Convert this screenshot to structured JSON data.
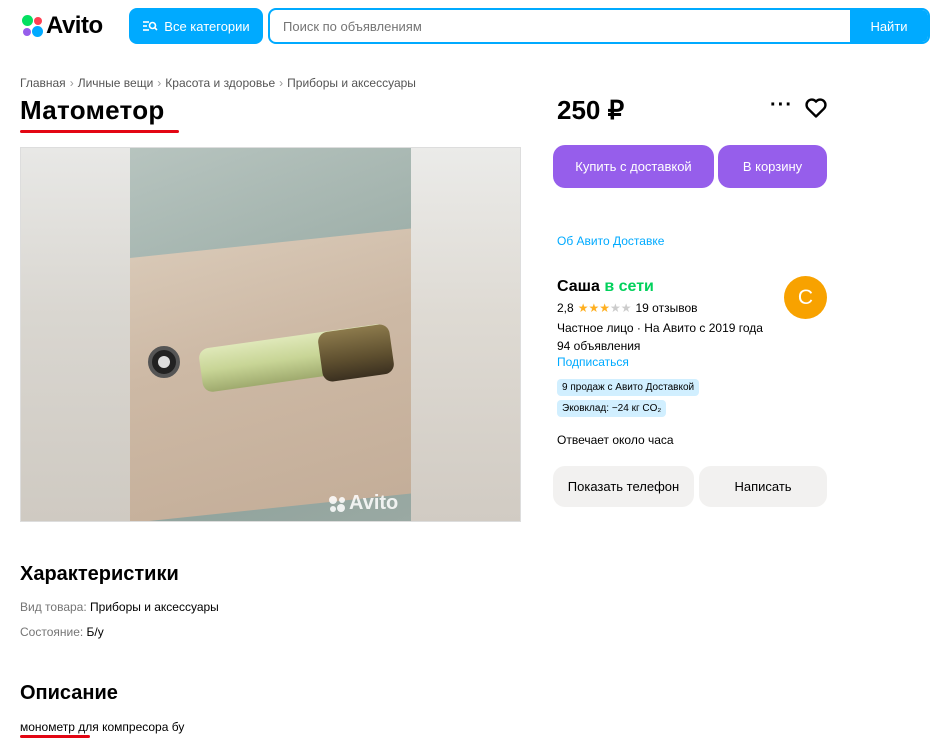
{
  "header": {
    "logo_text": "Avito",
    "categories_label": "Все категории",
    "search_placeholder": "Поиск по объявлениям",
    "search_button": "Найти"
  },
  "breadcrumbs": [
    "Главная",
    "Личные вещи",
    "Красота и здоровье",
    "Приборы и аксессуары"
  ],
  "breadcrumb_separator": "›",
  "listing": {
    "title": "Матометор",
    "price": "250 ₽",
    "watermark": "Avito"
  },
  "actions": {
    "buy_delivery": "Купить с доставкой",
    "add_to_cart": "В корзину",
    "delivery_info": "Об Авито Доставке"
  },
  "seller": {
    "name": "Саша",
    "status": "в сети",
    "avatar_letter": "С",
    "rating": "2,8",
    "rating_stars": 3,
    "reviews": "19 отзывов",
    "type_since": "Частное лицо · На Авито с 2019 года",
    "ads_count": "94 объявления",
    "subscribe": "Подписаться",
    "badges": [
      "9 продаж с Авито Доставкой",
      "Эковклад: −24 кг CO₂"
    ],
    "reply_time": "Отвечает около часа",
    "show_phone": "Показать телефон",
    "write": "Написать"
  },
  "characteristics": {
    "heading": "Характеристики",
    "items": [
      {
        "key": "Вид товара: ",
        "value": "Приборы и аксессуары"
      },
      {
        "key": "Состояние: ",
        "value": "Б/у"
      }
    ]
  },
  "description": {
    "heading": "Описание",
    "text": "монометр для компресора бу"
  },
  "colors": {
    "brand_blue": "#00aaff",
    "purple": "#965eeb",
    "online_green": "#02d15c",
    "annotation_red": "#e30613",
    "avatar_orange": "#f8a200"
  }
}
